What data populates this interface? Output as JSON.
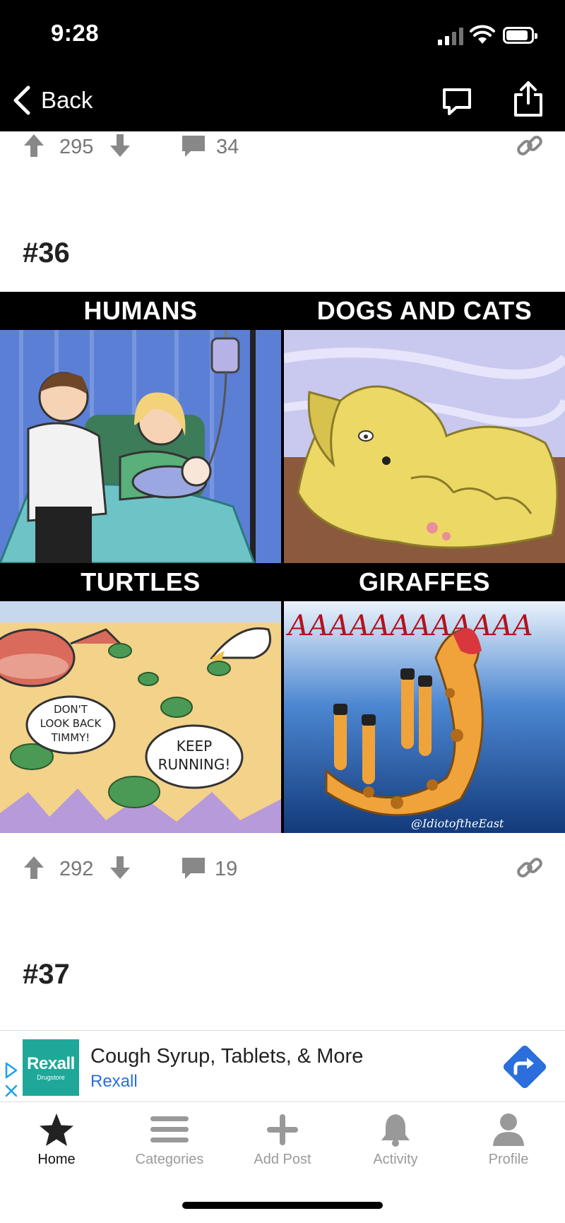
{
  "status_bar": {
    "time": "9:28"
  },
  "nav": {
    "back_label": "Back"
  },
  "posts": [
    {
      "upvotes": "295",
      "comments": "34"
    },
    {
      "number": "#36",
      "upvotes": "292",
      "comments": "19"
    },
    {
      "number": "#37"
    }
  ],
  "comic": {
    "panels": [
      {
        "label": "HUMANS"
      },
      {
        "label": "DOGS AND CATS"
      },
      {
        "label": "TURTLES"
      },
      {
        "label": "GIRAFFES"
      }
    ],
    "speech_1": [
      "DON'T",
      "LOOK BACK",
      "TIMMY!"
    ],
    "speech_2": [
      "KEEP",
      "RUNNING!"
    ],
    "scream": "AAAAAAAAAAAA",
    "watermark": "@IdiotoftheEast"
  },
  "ad": {
    "logo_brand": "Rexall",
    "logo_sub": "Drugstore",
    "headline": "Cough Syrup, Tablets, & More",
    "advertiser": "Rexall"
  },
  "tabs": [
    {
      "label": "Home",
      "icon": "star-icon"
    },
    {
      "label": "Categories",
      "icon": "menu-icon"
    },
    {
      "label": "Add Post",
      "icon": "plus-icon"
    },
    {
      "label": "Activity",
      "icon": "bell-icon"
    },
    {
      "label": "Profile",
      "icon": "user-icon"
    }
  ],
  "colors": {
    "accent": "#2a6fdb",
    "icon_gray": "#888888",
    "rexall_teal": "#1fa89a"
  }
}
